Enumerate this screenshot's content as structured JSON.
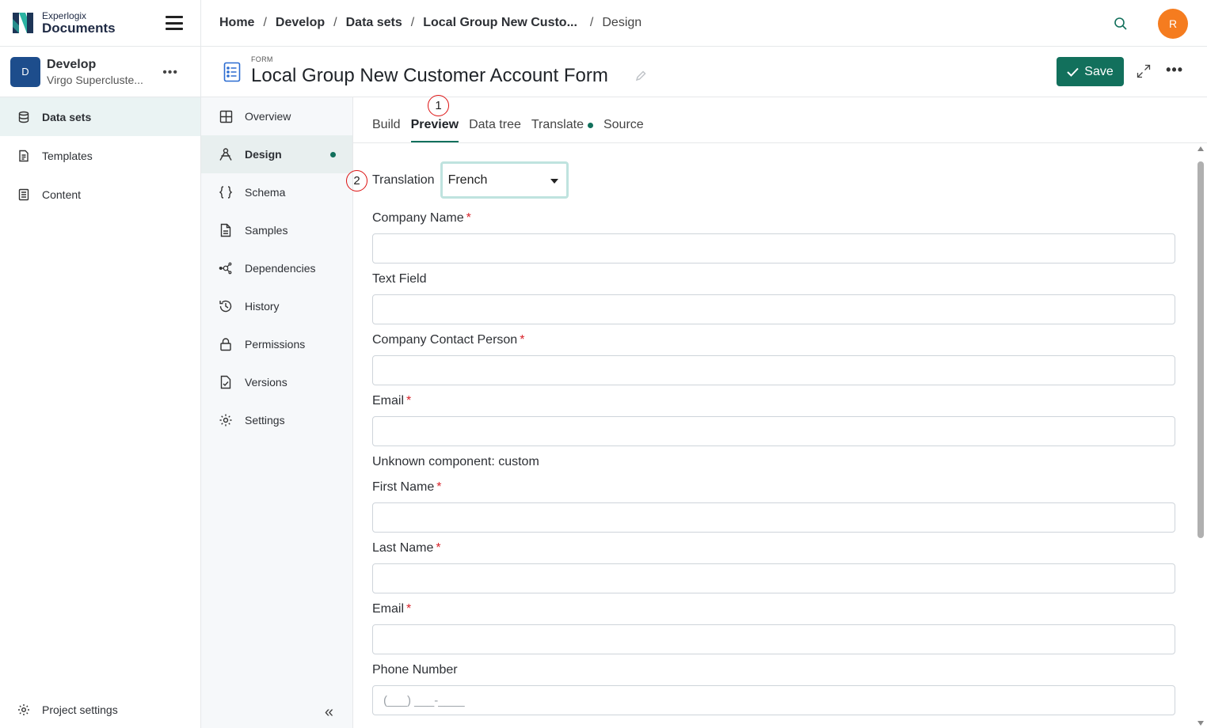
{
  "brand": {
    "small": "Experlogix",
    "big": "Documents"
  },
  "project": {
    "avatar": "D",
    "name": "Develop",
    "subtitle": "Virgo Supercluste...",
    "more": "•••"
  },
  "sidebar": {
    "items": [
      {
        "label": "Data sets",
        "icon": "database-icon",
        "active": true
      },
      {
        "label": "Templates",
        "icon": "template-icon",
        "active": false
      },
      {
        "label": "Content",
        "icon": "content-icon",
        "active": false
      }
    ],
    "project_settings": "Project settings"
  },
  "breadcrumb": [
    "Home",
    "Develop",
    "Data sets",
    "Local Group New Custo...",
    "Design"
  ],
  "breadcrumb_separator": "/",
  "user": {
    "initial": "R",
    "color": "#f57c1f"
  },
  "header": {
    "kind": "FORM",
    "title": "Local Group New Customer Account Form",
    "save_label": "Save",
    "more": "•••"
  },
  "subnav": {
    "items": [
      {
        "label": "Overview",
        "icon": "grid-icon"
      },
      {
        "label": "Design",
        "icon": "design-icon",
        "active": true,
        "dot": true
      },
      {
        "label": "Schema",
        "icon": "braces-icon"
      },
      {
        "label": "Samples",
        "icon": "file-icon"
      },
      {
        "label": "Dependencies",
        "icon": "network-icon"
      },
      {
        "label": "History",
        "icon": "history-icon"
      },
      {
        "label": "Permissions",
        "icon": "lock-icon"
      },
      {
        "label": "Versions",
        "icon": "file-check-icon"
      },
      {
        "label": "Settings",
        "icon": "gear-icon"
      }
    ],
    "collapse": "«"
  },
  "tabs": [
    {
      "label": "Build"
    },
    {
      "label": "Preview",
      "active": true
    },
    {
      "label": "Data tree"
    },
    {
      "label": "Translate",
      "dot": true
    },
    {
      "label": "Source"
    }
  ],
  "markers": [
    "1",
    "2"
  ],
  "form": {
    "translation_label": "Translation",
    "translation_value": "French",
    "fields": [
      {
        "label": "Company Name",
        "required": true,
        "value": ""
      },
      {
        "label": "Text Field",
        "required": false,
        "value": ""
      },
      {
        "label": "Company Contact Person",
        "required": true,
        "value": ""
      },
      {
        "label": "Email",
        "required": true,
        "value": ""
      },
      {
        "label": "First Name",
        "required": true,
        "value": ""
      },
      {
        "label": "Last Name",
        "required": true,
        "value": ""
      },
      {
        "label": "Email",
        "required": true,
        "value": ""
      },
      {
        "label": "Phone Number",
        "required": false,
        "placeholder": "(___) ___-____"
      }
    ],
    "unknown_component": "Unknown component: custom",
    "required_marker": "*"
  },
  "colors": {
    "accent": "#12705c",
    "required": "#d8232a",
    "project_avatar": "#1d4d8c"
  }
}
